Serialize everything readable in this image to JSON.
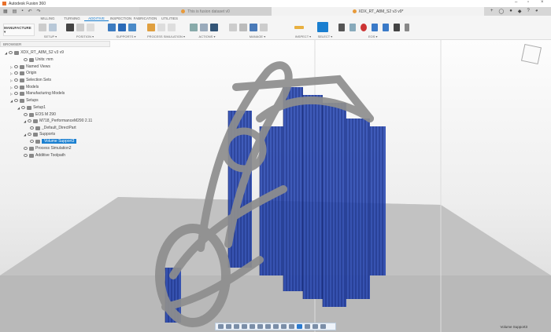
{
  "app": {
    "title": "Autodesk Fusion 360"
  },
  "quick_access": [
    "grid-icon",
    "file-icon",
    "save-icon",
    "undo-icon",
    "redo-icon"
  ],
  "doc_tabs": [
    {
      "label": "This is fusion dataset v0"
    },
    {
      "label": "XDX_RT_A8M_S2 v3 v9*"
    }
  ],
  "ribbon": {
    "workspace": "MANUFACTURE ▾",
    "tabs": [
      {
        "label": "MILLING"
      },
      {
        "label": "TURNING"
      },
      {
        "label": "ADDITIVE",
        "active": true
      },
      {
        "label": "INSPECTION"
      },
      {
        "label": "FABRICATION"
      },
      {
        "label": "UTILITIES"
      }
    ],
    "groups": [
      {
        "label": "SETUP ▾"
      },
      {
        "label": "POSITION ▾"
      },
      {
        "label": "SUPPORTS ▾"
      },
      {
        "label": "PROCESS SIMULATION ▾"
      },
      {
        "label": "ACTIONS ▾"
      },
      {
        "label": "MANAGE ▾"
      },
      {
        "label": "INSPECT ▾"
      },
      {
        "label": "SELECT ▾"
      },
      {
        "label": "EOS ▾"
      }
    ]
  },
  "browser": {
    "title": "BROWSER",
    "items": [
      {
        "label": "XDX_RT_A8M_S2 v3 v9"
      },
      {
        "label": "Units: mm"
      },
      {
        "label": "Named Views"
      },
      {
        "label": "Origin"
      },
      {
        "label": "Selection Sets"
      },
      {
        "label": "Models"
      },
      {
        "label": "Manufacturing Models"
      },
      {
        "label": "Setups"
      },
      {
        "label": "Setup1"
      },
      {
        "label": "EOS M 290"
      },
      {
        "label": "M718_PerformanceM290 2.11"
      },
      {
        "label": "_Default_DirectPart"
      },
      {
        "label": "Supports"
      },
      {
        "label": "Volume Support3",
        "selected": true
      },
      {
        "label": "Process Simulation2"
      },
      {
        "label": "Additive Toolpath"
      }
    ]
  },
  "status": {
    "text": "Volume Support3"
  },
  "colors": {
    "accent": "#1a7fd0",
    "support": "#1f3fae",
    "part": "#9a9a9a"
  }
}
